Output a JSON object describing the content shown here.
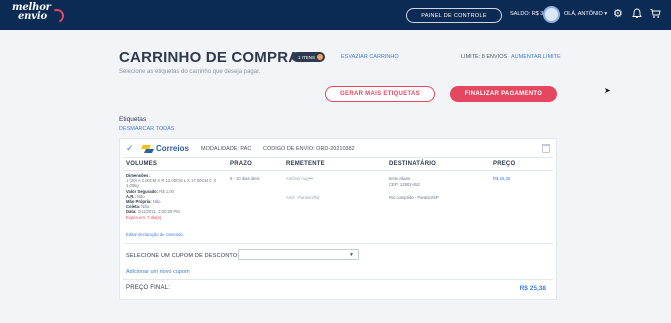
{
  "topbar": {
    "logo_line1": "melhor",
    "logo_line2": "envio",
    "panel_button": "PAINEL DE CONTROLE",
    "balance": "SALDO: R$ 355,13",
    "user": "OLÁ, ANTÔNIO"
  },
  "header": {
    "title": "CARRINHO DE COMPRAS",
    "items_badge": "1 ITENS",
    "empty_link": "ESVAZIAR CARRINHO",
    "subtitle": "Selecione as etiquetas do carrinho que deseja pagar.",
    "limit": "LIMITE: 8 ENVIOS",
    "raise_limit": "AUMENTAR LIMITE"
  },
  "actions": {
    "generate": "GERAR MAIS ETIQUETAS",
    "pay": "FINALIZAR PAGAMENTO"
  },
  "labels_section": {
    "title": "Etiquetas",
    "unselect": "DESMARCAR TODAS"
  },
  "card": {
    "carrier": "Correios",
    "modality": "MODALIDADE: PAC",
    "tracking": "CÓDIGO DE ENVIO: ORD-20210382",
    "columns": [
      "VOLUMES",
      "PRAZO",
      "REMETENTE",
      "DESTINATÁRIO",
      "PREÇO"
    ],
    "volumes": {
      "dims_label": "Dimensões:",
      "dims": "1 (20) A 2.00CM X R 12.00CM L X 17.00CM C X",
      "weight": "1,00kg",
      "insured_label": "Valor Segurado:",
      "insured": "R$ 1,00",
      "ar_label": "A.R.:",
      "ar": "Não",
      "own_hand_label": "Mão Própria:",
      "own_hand": "Não",
      "collect_label": "Coleta:",
      "collect": "Não",
      "date_label": "Data:",
      "date": "3/11/2021, 2:20:29 PM",
      "expires": "Expira em: 7 dia(s)",
      "edit_link": "Editar declaração de conteúdo"
    },
    "deadline": "9 - 10 dias úteis",
    "sender_name": "Antônio Aug•••",
    "sender_addr": "Ariúl - Paraíso/RS",
    "recipient_name": "teste eliane",
    "recipient_cep": "CEP: 12902-452",
    "recipient_addr": "Rio cumprido - Paraíso/SP",
    "price": "R$ 25,38"
  },
  "coupon": {
    "label": "SELECIONE UM CUPOM DE DESCONTO:",
    "add_link": "Adicionar um novo cupom"
  },
  "total": {
    "label": "PREÇO FINAL:",
    "value": "R$ 25,38"
  }
}
